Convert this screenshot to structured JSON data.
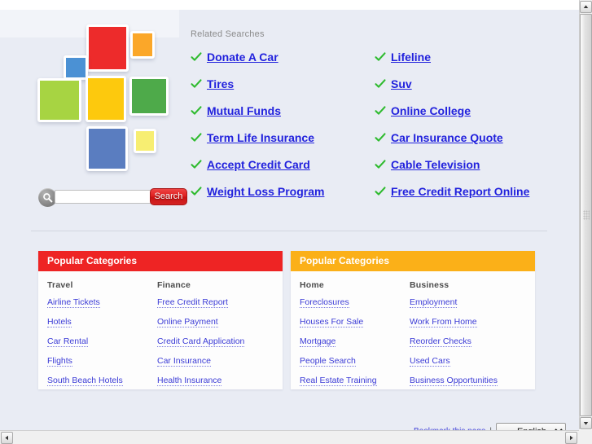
{
  "related": {
    "heading": "Related Searches",
    "links_left": [
      "Donate A Car",
      "Tires",
      "Mutual Funds",
      "Term Life Insurance",
      "Accept Credit Card",
      "Weight Loss Program"
    ],
    "links_right": [
      "Lifeline",
      "Suv",
      "Online College",
      "Car Insurance Quote",
      "Cable Television",
      "Free Credit Report Online"
    ]
  },
  "search": {
    "value": "",
    "placeholder": "",
    "button_label": "Search",
    "icon": "magnifier-icon"
  },
  "logo": {
    "tiles": [
      {
        "name": "tile-red",
        "color": "#ed2b2b"
      },
      {
        "name": "tile-orange",
        "color": "#fba729"
      },
      {
        "name": "tile-blue-small",
        "color": "#4b91d4"
      },
      {
        "name": "tile-lime",
        "color": "#a7d442"
      },
      {
        "name": "tile-yellow",
        "color": "#fdc90d"
      },
      {
        "name": "tile-green",
        "color": "#4eaa4a"
      },
      {
        "name": "tile-dark-blue",
        "color": "#5a7dc0"
      },
      {
        "name": "tile-pale-yellow",
        "color": "#f7ee72"
      }
    ]
  },
  "panels": [
    {
      "title": "Popular Categories",
      "accent": "#ee2424",
      "columns": [
        {
          "title": "Travel",
          "links": [
            "Airline Tickets",
            "Hotels",
            "Car Rental",
            "Flights",
            "South Beach Hotels"
          ]
        },
        {
          "title": "Finance",
          "links": [
            "Free Credit Report",
            "Online Payment",
            "Credit Card Application",
            "Car Insurance",
            "Health Insurance"
          ]
        }
      ]
    },
    {
      "title": "Popular Categories",
      "accent": "#fbb018",
      "columns": [
        {
          "title": "Home",
          "links": [
            "Foreclosures",
            "Houses For Sale",
            "Mortgage",
            "People Search",
            "Real Estate Training"
          ]
        },
        {
          "title": "Business",
          "links": [
            "Employment",
            "Work From Home",
            "Reorder Checks",
            "Used Cars",
            "Business Opportunities"
          ]
        }
      ]
    }
  ],
  "footer": {
    "bookmark_label": "Bookmark this page",
    "separator": "|",
    "language_selected": "English",
    "language_options": [
      "English"
    ]
  },
  "colors": {
    "page_background": "#e9ecf4",
    "link_blue": "#2222dd",
    "check_green": "#2fbb2f",
    "panel_red": "#ee2424",
    "panel_orange": "#fbb018",
    "search_button_red": "#de1f1f"
  }
}
